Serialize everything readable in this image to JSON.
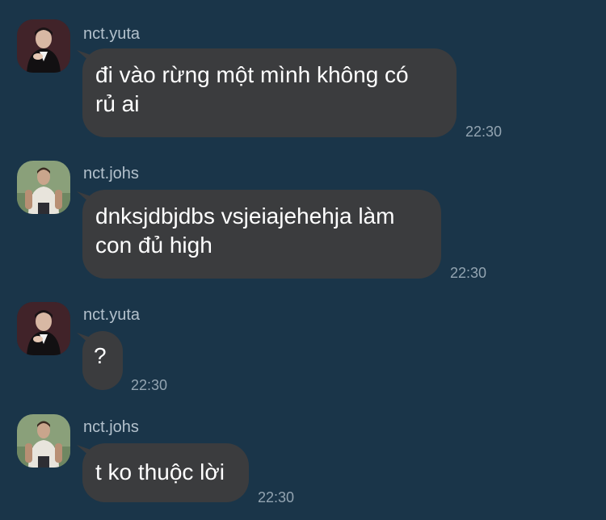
{
  "messages": [
    {
      "sender": "nct.yuta",
      "avatar": "avatar-yuta",
      "text_lines": [
        "đi vào rừng một mình không có",
        "rủ ai"
      ],
      "time": "22:30"
    },
    {
      "sender": "nct.johs",
      "avatar": "avatar-johnny",
      "text_lines": [
        "dnksjdbjdbs vsjeiajehehja làm",
        "con đủ high"
      ],
      "time": "22:30"
    },
    {
      "sender": "nct.yuta",
      "avatar": "avatar-yuta",
      "text_lines": [
        "?"
      ],
      "time": "22:30"
    },
    {
      "sender": "nct.johs",
      "avatar": "avatar-johnny",
      "text_lines": [
        "t ko thuộc lời"
      ],
      "time": "22:30"
    }
  ],
  "colors": {
    "background": "#1a3549",
    "bubble": "#3b3c3e",
    "sender_name": "#b3c1cc",
    "timestamp": "#93a4b1",
    "message_text": "#ffffff"
  }
}
